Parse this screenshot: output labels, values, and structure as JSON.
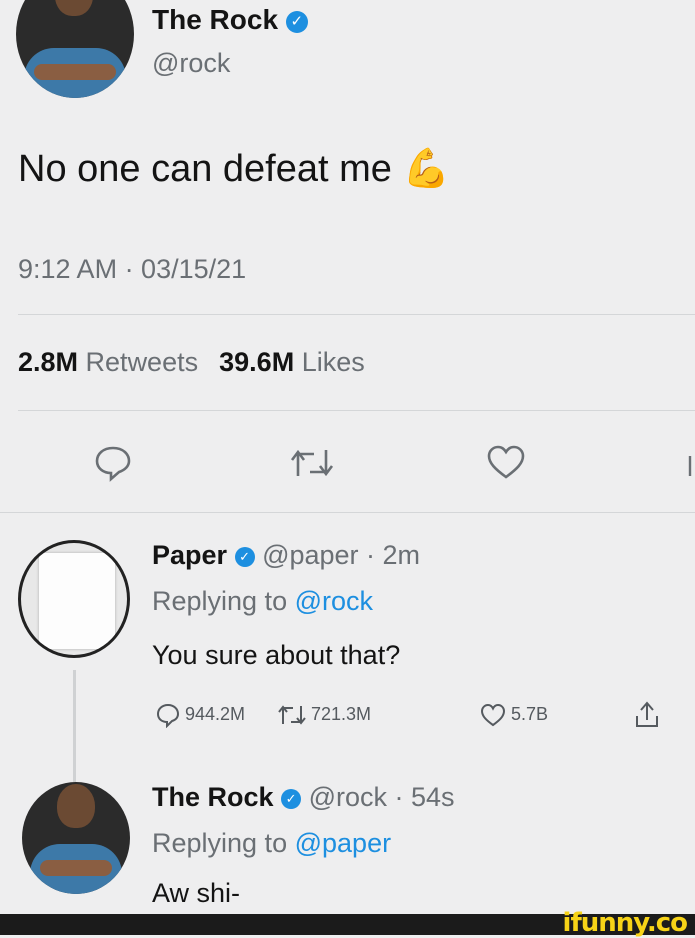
{
  "main_tweet": {
    "name": "The Rock",
    "handle": "@rock",
    "text": "No one can defeat me",
    "emoji": "💪",
    "timestamp": "9:12 AM · 03/15/21",
    "retweets_count": "2.8M",
    "retweets_label": "Retweets",
    "likes_count": "39.6M",
    "likes_label": "Likes"
  },
  "reply1": {
    "name": "Paper",
    "handle_time": "@paper · 2m",
    "replying_prefix": "Replying to",
    "replying_handle": "@rock",
    "text": "You sure about that?",
    "reply_count": "944.2M",
    "retweet_count": "721.3M",
    "like_count": "5.7B"
  },
  "reply2": {
    "name": "The Rock",
    "handle_time": "@rock · 54s",
    "replying_prefix": "Replying to",
    "replying_handle": "@paper",
    "text": "Aw shi-"
  },
  "watermark": "ifunny.co",
  "colors": {
    "accent": "#1d8fe0",
    "background": "#eeeeef",
    "text": "#141414",
    "secondary": "#6a6f74",
    "watermark": "#f7d317"
  }
}
